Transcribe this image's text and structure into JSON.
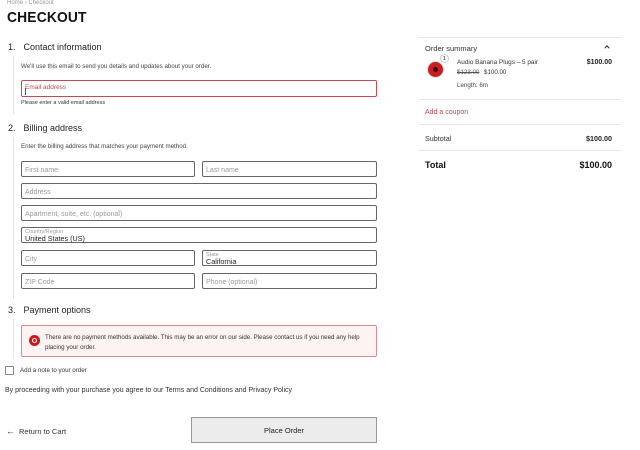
{
  "breadcrumb": {
    "home": "Home",
    "separator": "›",
    "current": "Checkout"
  },
  "page_title": "CHECKOUT",
  "contact": {
    "number": "1.",
    "title": "Contact information",
    "description": "We'll use this email to send you details and updates about your order.",
    "email_placeholder": "Email address",
    "error_text": "Please enter a valid email address"
  },
  "billing": {
    "number": "2.",
    "title": "Billing address",
    "description": "Enter the billing address that matches your payment method.",
    "first_name": "First name",
    "last_name": "Last name",
    "address": "Address",
    "apartment": "Apartment, suite, etc. (optional)",
    "country_label": "Country/Region",
    "country_value": "United States (US)",
    "city": "City",
    "state_label": "State",
    "state_value": "California",
    "zip": "ZIP Code",
    "phone": "Phone (optional)"
  },
  "payment": {
    "number": "3.",
    "title": "Payment options",
    "notice": "There are no payment methods available. This may be an error on our side. Please contact us if you need any help placing your order.",
    "notice_icon": "error-icon",
    "notice_color": "#cc1818"
  },
  "note_checkbox_label": "Add a note to your order",
  "terms_text": "By proceeding with your purchase you agree to our Terms and Conditions and Privacy Policy",
  "return_link": {
    "arrow": "←",
    "label": "Return to Cart"
  },
  "place_order_label": "Place Order",
  "summary": {
    "title": "Order summary",
    "item": {
      "quantity": "1",
      "name": "Audio Banana Plugs – 5 pair",
      "line_total": "$100.00",
      "regular_price": "$123.00",
      "sale_price": "$100.00",
      "meta": "Length: 6m"
    },
    "coupon_label": "Add a coupon",
    "subtotal_label": "Subtotal",
    "subtotal_value": "$100.00",
    "total_label": "Total",
    "total_value": "$100.00",
    "accent_color": "#c0454d"
  }
}
